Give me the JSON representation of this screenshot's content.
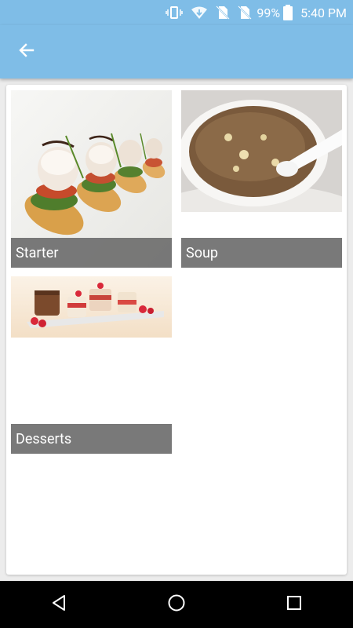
{
  "status_bar": {
    "battery": "99%",
    "time": "5:40 PM",
    "icons": [
      "vibrate-icon",
      "wifi-download-icon",
      "no-sim-icon",
      "no-sim-icon-2",
      "battery-icon"
    ]
  },
  "app_bar": {
    "color": "#7fbde7",
    "back_icon": "arrow-left-icon"
  },
  "categories": [
    {
      "label": "Starter",
      "image": "scallop-appetizer-photo"
    },
    {
      "label": "Soup",
      "image": "egg-drop-soup-photo"
    },
    {
      "label": "Desserts",
      "image": "dessert-cups-photo"
    }
  ],
  "nav_bar": {
    "icons": [
      "back-triangle-icon",
      "home-circle-icon",
      "recents-square-icon"
    ]
  }
}
